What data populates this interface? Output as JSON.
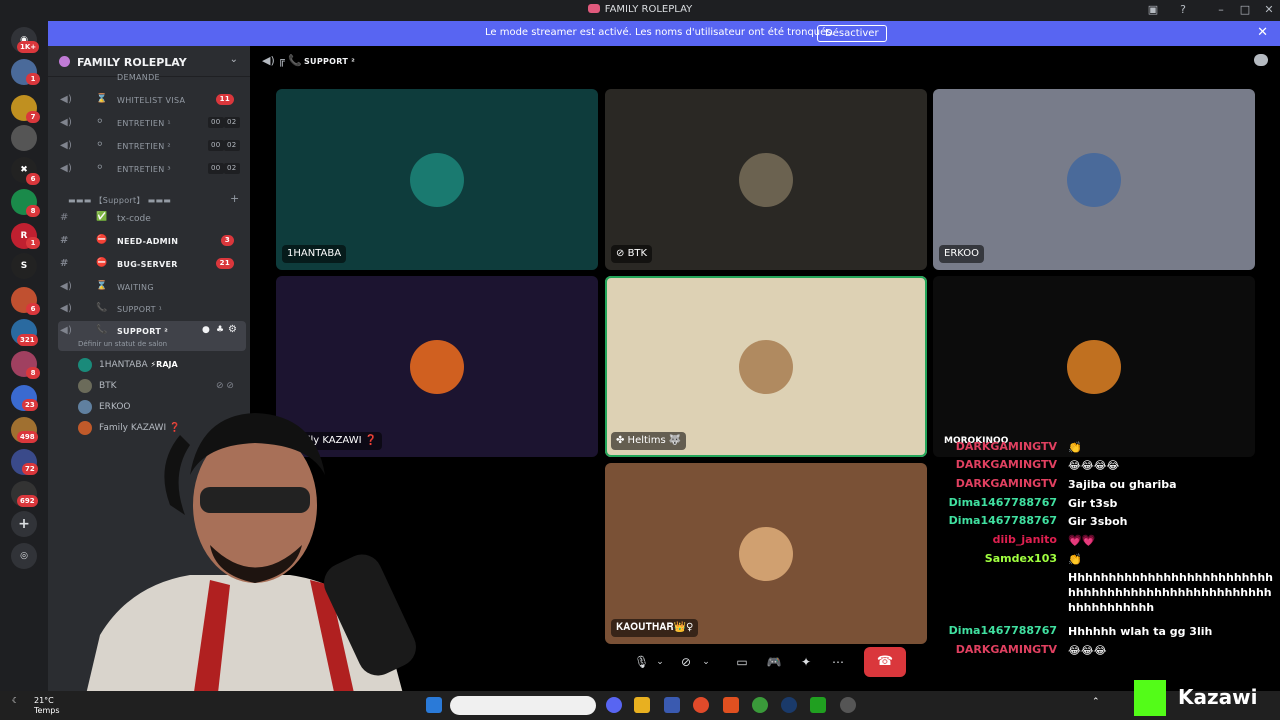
{
  "window": {
    "title": "FAMILY ROLEPLAY"
  },
  "banner": {
    "message": "Le mode streamer est activé. Les noms d'utilisateur ont été tronqués.",
    "button": "Désactiver"
  },
  "rail": {
    "badges": [
      "1K+",
      "1",
      "7",
      "6",
      "8",
      "1",
      "6",
      "321",
      "8",
      "23",
      "498",
      "72",
      "692"
    ]
  },
  "server": {
    "name": "FAMILY ROLEPLAY",
    "category": "▬▬▬ 【Support】 ▬▬▬",
    "channels": [
      {
        "label": "DEMANDE",
        "emoji": ""
      },
      {
        "label": "WHITELIST VISA",
        "emoji": "⌛",
        "count": "11"
      },
      {
        "label": "ENTRETIEN ¹",
        "emoji": "⚪",
        "t1": "00",
        "t2": "02"
      },
      {
        "label": "ENTRETIEN ²",
        "emoji": "⚪",
        "t1": "00",
        "t2": "02"
      },
      {
        "label": "ENTRETIEN ³",
        "emoji": "⚪",
        "t1": "00",
        "t2": "02"
      }
    ],
    "text_channels": [
      {
        "label": "tx-code",
        "emoji": "✅"
      },
      {
        "label": "NEED-ADMIN",
        "emoji": "⛔",
        "count": "3"
      },
      {
        "label": "BUG-SERVER",
        "emoji": "⛔",
        "count": "21"
      }
    ],
    "voice_channels": [
      {
        "label": "WAITING",
        "emoji": "⌛"
      },
      {
        "label": "SUPPORT ¹",
        "emoji": "📞"
      },
      {
        "label": "SUPPORT ²",
        "emoji": "📞",
        "status": "Définir un statut de salon"
      }
    ],
    "members": [
      {
        "name": "1HANTABA",
        "tag": "⚡RAJA",
        "color": "#1a8a7a"
      },
      {
        "name": "BTK",
        "color": "#6b6b5a"
      },
      {
        "name": "ERKOO",
        "color": "#6080a0"
      },
      {
        "name": "Family KAZAWI ❓",
        "color": "#c05a2a"
      }
    ]
  },
  "voice": {
    "channel_title": "SUPPORT ²",
    "tiles": [
      {
        "name": "1HANTABA",
        "bg": "#0e3c3c",
        "avatar": "#1a7a70"
      },
      {
        "name": "BTK",
        "bg": "#2a2824",
        "avatar": "#6b6250"
      },
      {
        "name": "ERKOO",
        "bg": "#787c8a",
        "avatar": "#4a6a9a"
      },
      {
        "name": "Family KAZAWI ❓",
        "bg": "#1c1430",
        "avatar": "#d06020"
      },
      {
        "name": "✤ Heltims 🐺",
        "bg": "#ddd1b4",
        "avatar": "#b08a60"
      },
      {
        "name": "MOROKINOO",
        "bg": "#0c0c0c",
        "avatar": "#c07020"
      },
      {
        "name": "𝐊𝐀𝐎𝐔𝐓𝐇𝐀𝐑👑♀",
        "bg": "#7a5136",
        "avatar": "#d0a070"
      }
    ]
  },
  "chat": [
    {
      "user": "DARKGAMINGTV",
      "color": "#e04060",
      "text": "👏"
    },
    {
      "user": "DARKGAMINGTV",
      "color": "#e04060",
      "text": "😂😂😂😂"
    },
    {
      "user": "DARKGAMINGTV",
      "color": "#e04060",
      "text": "3ajiba ou ghariba"
    },
    {
      "user": "Dima1467788767",
      "color": "#40e0a0",
      "text": "Gir t3sb"
    },
    {
      "user": "Dima1467788767",
      "color": "#40e0a0",
      "text": "Gir 3sboh"
    },
    {
      "user": "diib_janito",
      "color": "#e02050",
      "text": "💗💗"
    },
    {
      "user": "Samdex103",
      "color": "#a0ff40",
      "text": "👏"
    },
    {
      "user": "",
      "color": "#ffffff",
      "text": "Hhhhhhhhhhhhhhhhhhhhhhhhhhhhhhhhhhhhhhhhhhhhhhhhhhhhhhhhhhhhhhh"
    },
    {
      "user": "Dima1467788767",
      "color": "#40e0a0",
      "text": "Hhhhhh wlah ta gg 3lih"
    },
    {
      "user": "DARKGAMINGTV",
      "color": "#e04060",
      "text": "😂😂😂"
    }
  ],
  "taskbar": {
    "temp": "21°C",
    "weather": "Temps"
  },
  "watermark": {
    "text": "Kazawi"
  }
}
